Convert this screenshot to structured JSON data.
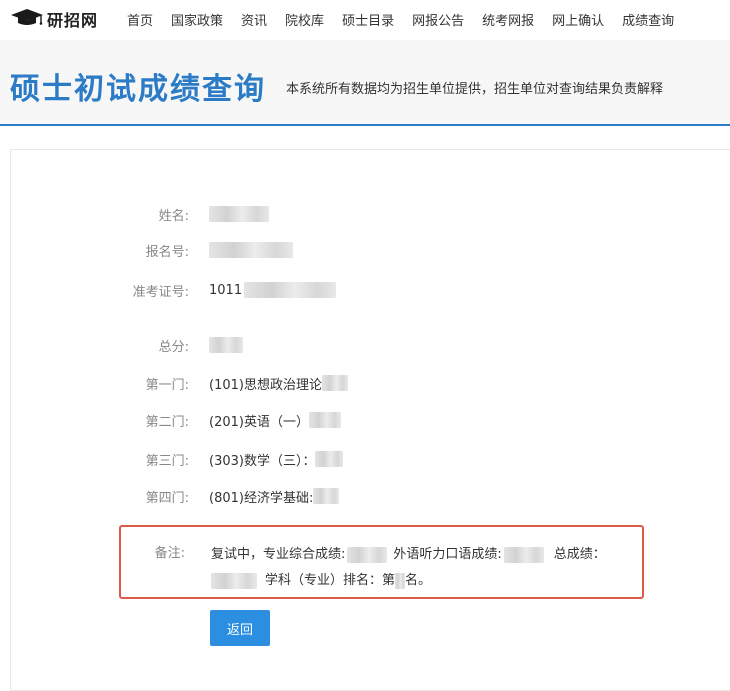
{
  "brand": {
    "name": "研招网"
  },
  "nav": {
    "items": [
      "首页",
      "国家政策",
      "资讯",
      "院校库",
      "硕士目录",
      "网报公告",
      "统考网报",
      "网上确认",
      "成绩查询"
    ]
  },
  "header": {
    "title": "硕士初试成绩查询",
    "subtitle": "本系统所有数据均为招生单位提供，招生单位对查询结果负责解释"
  },
  "result": {
    "name_label": "姓名:",
    "reg_label": "报名号:",
    "exam_label": "准考证号:",
    "exam_prefix": "1011",
    "total_label": "总分:",
    "subject1_label": "第一门:",
    "subject1_value": "(101)思想政治理论",
    "subject2_label": "第二门:",
    "subject2_value": "(201)英语（一）",
    "subject3_label": "第三门:",
    "subject3_value": "(303)数学（三）：",
    "subject4_label": "第四门:",
    "subject4_value": "(801)经济学基础:",
    "note_label": "备注:",
    "note_part1": "复试中，专业综合成绩:",
    "note_part2": "外语听力口语成绩:",
    "note_part3": "总成绩：",
    "note_part4": "学科（专业）排名：第",
    "note_part5": "名。"
  },
  "actions": {
    "back_label": "返回"
  },
  "colors": {
    "accent": "#2b7bc6",
    "button": "#2b8ee0",
    "highlight_border": "#e05a4b"
  }
}
